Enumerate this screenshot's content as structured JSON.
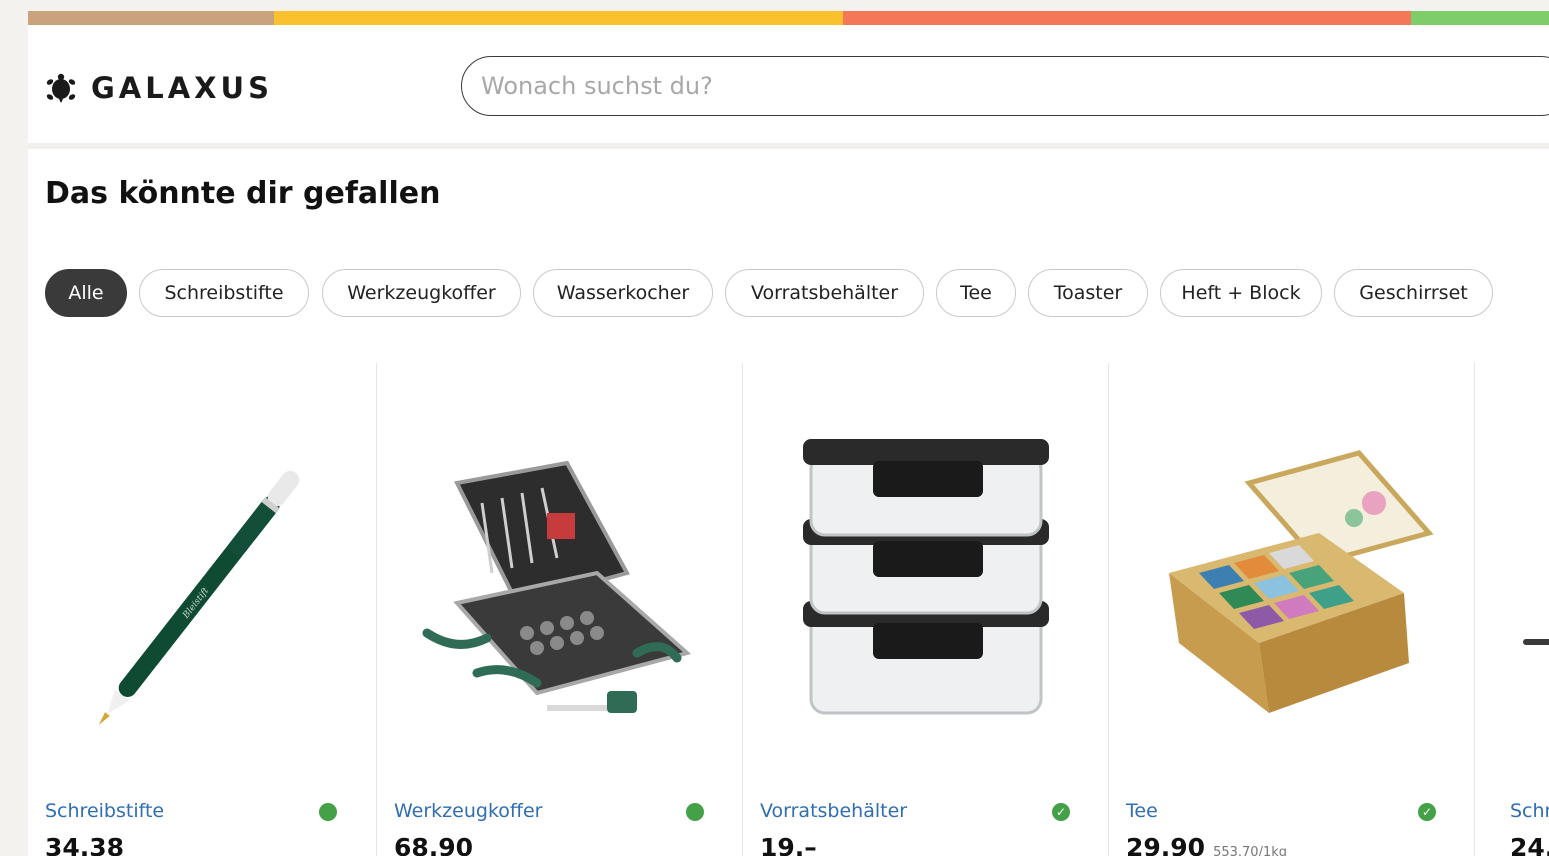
{
  "colors": {
    "bar_segments": [
      "#c9a27e",
      "#fbc02d",
      "#f4775a",
      "#7fcd6a"
    ],
    "stock_green": "#45a147",
    "category_blue": "#2f6eb3"
  },
  "header": {
    "logo_text": "GALAXUS",
    "logo_icon": "turtle-icon",
    "search_placeholder": "Wonach suchst du?"
  },
  "section": {
    "title": "Das könnte dir gefallen"
  },
  "chips": [
    {
      "label": "Alle",
      "active": true
    },
    {
      "label": "Schreibstifte",
      "active": false
    },
    {
      "label": "Werkzeugkoffer",
      "active": false
    },
    {
      "label": "Wasserkocher",
      "active": false
    },
    {
      "label": "Vorratsbehälter",
      "active": false
    },
    {
      "label": "Tee",
      "active": false
    },
    {
      "label": "Toaster",
      "active": false
    },
    {
      "label": "Heft + Block",
      "active": false
    },
    {
      "label": "Geschirrset",
      "active": false
    }
  ],
  "products": [
    {
      "category": "Schreibstifte",
      "price": "34.38",
      "unit_price": "",
      "image": "pen-image",
      "stock": "dot"
    },
    {
      "category": "Werkzeugkoffer",
      "price": "68.90",
      "unit_price": "",
      "image": "toolbox-image",
      "stock": "dot"
    },
    {
      "category": "Vorratsbehälter",
      "price": "19.–",
      "unit_price": "",
      "image": "food-containers-image",
      "stock": "check"
    },
    {
      "category": "Tee",
      "price": "29.90",
      "unit_price": "553.70/1kg",
      "image": "tea-box-image",
      "stock": "check"
    },
    {
      "category": "Schr",
      "price": "24.",
      "unit_price": "",
      "image": "pen-image",
      "stock": "dot"
    }
  ]
}
